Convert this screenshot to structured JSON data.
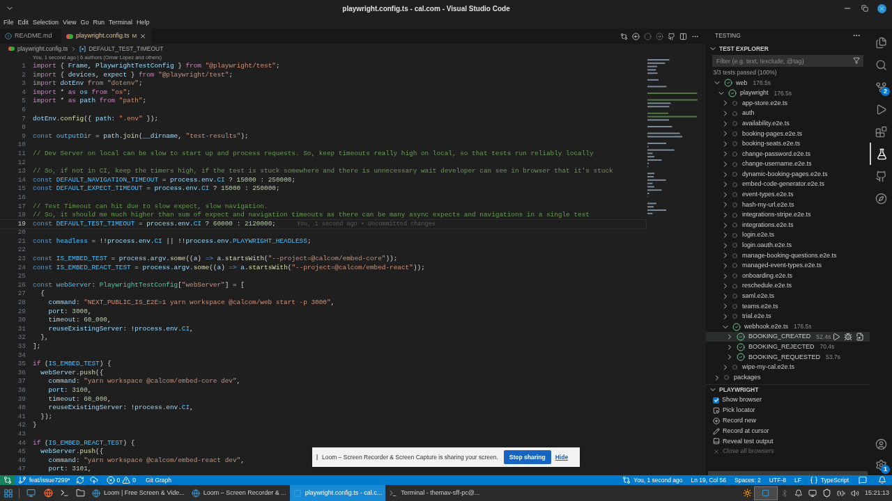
{
  "window": {
    "title": "playwright.config.ts - cal.com - Visual Studio Code"
  },
  "menu": [
    "File",
    "Edit",
    "Selection",
    "View",
    "Go",
    "Run",
    "Terminal",
    "Help"
  ],
  "tabs": [
    {
      "label": "README.md",
      "selected": false,
      "modified": false,
      "kind": "markdown"
    },
    {
      "label": "playwright.config.ts",
      "selected": true,
      "modified": true,
      "badge": "M",
      "kind": "playwright"
    }
  ],
  "breadcrumbs": [
    "playwright.config.ts",
    "DEFAULT_TEST_TIMEOUT"
  ],
  "blame_header": "You, 1 second ago | 6 authors (Omar López and others)",
  "code": [
    {
      "n": "1",
      "current": false,
      "tokens": [
        {
          "kind": "ctl",
          "text": "import"
        },
        {
          "kind": "p",
          "text": " { "
        },
        {
          "kind": "v",
          "text": "Frame"
        },
        {
          "kind": "p",
          "text": ", "
        },
        {
          "kind": "v",
          "text": "PlaywrightTestConfig"
        },
        {
          "kind": "p",
          "text": " } "
        },
        {
          "kind": "ctl",
          "text": "from "
        },
        {
          "kind": "s",
          "text": "\"@playwright/test\""
        },
        {
          "kind": "p",
          "text": ";"
        }
      ]
    },
    {
      "n": "2",
      "current": false,
      "tokens": [
        {
          "kind": "ctl",
          "text": "import"
        },
        {
          "kind": "p",
          "text": " { "
        },
        {
          "kind": "v",
          "text": "devices"
        },
        {
          "kind": "p",
          "text": ", "
        },
        {
          "kind": "v",
          "text": "expect"
        },
        {
          "kind": "p",
          "text": " } "
        },
        {
          "kind": "ctl",
          "text": "from "
        },
        {
          "kind": "s",
          "text": "\"@playwright/test\""
        },
        {
          "kind": "p",
          "text": ";"
        }
      ]
    },
    {
      "n": "3",
      "current": false,
      "tokens": [
        {
          "kind": "ctl",
          "text": "import "
        },
        {
          "kind": "v",
          "text": "dotEnv "
        },
        {
          "kind": "ctl",
          "text": "from "
        },
        {
          "kind": "s",
          "text": "\"dotenv\""
        },
        {
          "kind": "p",
          "text": ";"
        }
      ]
    },
    {
      "n": "4",
      "current": false,
      "tokens": [
        {
          "kind": "ctl",
          "text": "import"
        },
        {
          "kind": "p",
          "text": " * "
        },
        {
          "kind": "ctl",
          "text": "as "
        },
        {
          "kind": "v",
          "text": "os "
        },
        {
          "kind": "ctl",
          "text": "from "
        },
        {
          "kind": "s",
          "text": "\"os\""
        },
        {
          "kind": "p",
          "text": ";"
        }
      ]
    },
    {
      "n": "5",
      "current": false,
      "tokens": [
        {
          "kind": "ctl",
          "text": "import"
        },
        {
          "kind": "p",
          "text": " * "
        },
        {
          "kind": "ctl",
          "text": "as "
        },
        {
          "kind": "v",
          "text": "path "
        },
        {
          "kind": "ctl",
          "text": "from "
        },
        {
          "kind": "s",
          "text": "\"path\""
        },
        {
          "kind": "p",
          "text": ";"
        }
      ]
    },
    {
      "n": "6",
      "current": false
    },
    {
      "n": "7",
      "current": false,
      "tokens": [
        {
          "kind": "v",
          "text": "dotEnv"
        },
        {
          "kind": "p",
          "text": "."
        },
        {
          "kind": "f",
          "text": "config"
        },
        {
          "kind": "p",
          "text": "({ "
        },
        {
          "kind": "v",
          "text": "path"
        },
        {
          "kind": "p",
          "text": ": "
        },
        {
          "kind": "s",
          "text": "\".env\""
        },
        {
          "kind": "p",
          "text": " });"
        }
      ]
    },
    {
      "n": "8",
      "current": false
    },
    {
      "n": "9",
      "current": false,
      "tokens": [
        {
          "kind": "kw",
          "text": "const "
        },
        {
          "kind": "cn",
          "text": "outputDir"
        },
        {
          "kind": "p",
          "text": " = "
        },
        {
          "kind": "v",
          "text": "path"
        },
        {
          "kind": "p",
          "text": "."
        },
        {
          "kind": "f",
          "text": "join"
        },
        {
          "kind": "p",
          "text": "("
        },
        {
          "kind": "v",
          "text": "__dirname"
        },
        {
          "kind": "p",
          "text": ", "
        },
        {
          "kind": "s",
          "text": "\"test-results\""
        },
        {
          "kind": "p",
          "text": ");"
        }
      ]
    },
    {
      "n": "10",
      "current": false
    },
    {
      "n": "11",
      "current": false,
      "tokens": [
        {
          "kind": "c",
          "text": "// Dev Server on local can be slow to start up and process requests. So, keep timeouts really high on local, so that tests run reliably locally"
        }
      ]
    },
    {
      "n": "12",
      "current": false
    },
    {
      "n": "13",
      "current": false,
      "tokens": [
        {
          "kind": "c",
          "text": "// So, if not in CI, keep the timers high, if the test is stuck somewhere and there is unnecessary wait developer can see in browser that it's stuck"
        }
      ]
    },
    {
      "n": "14",
      "current": false,
      "tokens": [
        {
          "kind": "kw",
          "text": "const "
        },
        {
          "kind": "cn",
          "text": "DEFAULT_NAVIGATION_TIMEOUT"
        },
        {
          "kind": "p",
          "text": " = "
        },
        {
          "kind": "v",
          "text": "process.env."
        },
        {
          "kind": "cn",
          "text": "CI"
        },
        {
          "kind": "p",
          "text": " ? "
        },
        {
          "kind": "n",
          "text": "15000"
        },
        {
          "kind": "p",
          "text": " : "
        },
        {
          "kind": "n",
          "text": "250000"
        },
        {
          "kind": "p",
          "text": ";"
        }
      ]
    },
    {
      "n": "15",
      "current": false,
      "tokens": [
        {
          "kind": "kw",
          "text": "const "
        },
        {
          "kind": "cn",
          "text": "DEFAULT_EXPECT_TIMEOUT"
        },
        {
          "kind": "p",
          "text": " = "
        },
        {
          "kind": "v",
          "text": "process.env."
        },
        {
          "kind": "cn",
          "text": "CI"
        },
        {
          "kind": "p",
          "text": " ? "
        },
        {
          "kind": "n",
          "text": "15000"
        },
        {
          "kind": "p",
          "text": " : "
        },
        {
          "kind": "n",
          "text": "250000"
        },
        {
          "kind": "p",
          "text": ";"
        }
      ]
    },
    {
      "n": "16",
      "current": false
    },
    {
      "n": "17",
      "current": false,
      "tokens": [
        {
          "kind": "c",
          "text": "// Test Timeout can hit due to slow expect, slow navigation."
        }
      ]
    },
    {
      "n": "18",
      "current": false,
      "tokens": [
        {
          "kind": "c",
          "text": "// So, it should me much higher than sum of expect and navigation timeouts as there can be many async expects and navigations in a single test"
        }
      ]
    },
    {
      "n": "19",
      "current": true,
      "annotation": "You, 1 second ago • Uncommitted changes",
      "tokens": [
        {
          "kind": "kw",
          "text": "const "
        },
        {
          "kind": "cn",
          "text": "DEFAULT_TEST_TIMEOUT"
        },
        {
          "kind": "p",
          "text": " = "
        },
        {
          "kind": "v",
          "text": "process.env."
        },
        {
          "kind": "cn",
          "text": "CI"
        },
        {
          "kind": "p",
          "text": " ? "
        },
        {
          "kind": "n",
          "text": "60000"
        },
        {
          "kind": "p",
          "text": " : "
        },
        {
          "kind": "n",
          "text": "2120000"
        },
        {
          "kind": "p",
          "text": ";"
        }
      ]
    },
    {
      "n": "20",
      "current": false
    },
    {
      "n": "21",
      "current": false,
      "tokens": [
        {
          "kind": "kw",
          "text": "const "
        },
        {
          "kind": "cn",
          "text": "headless"
        },
        {
          "kind": "p",
          "text": " = !!"
        },
        {
          "kind": "v",
          "text": "process.env."
        },
        {
          "kind": "cn",
          "text": "CI"
        },
        {
          "kind": "p",
          "text": " || !!"
        },
        {
          "kind": "v",
          "text": "process.env."
        },
        {
          "kind": "cn",
          "text": "PLAYWRIGHT_HEADLESS"
        },
        {
          "kind": "p",
          "text": ";"
        }
      ]
    },
    {
      "n": "22",
      "current": false
    },
    {
      "n": "23",
      "current": false,
      "tokens": [
        {
          "kind": "kw",
          "text": "const "
        },
        {
          "kind": "cn",
          "text": "IS_EMBED_TEST"
        },
        {
          "kind": "p",
          "text": " = "
        },
        {
          "kind": "v",
          "text": "process.argv."
        },
        {
          "kind": "f",
          "text": "some"
        },
        {
          "kind": "p",
          "text": "(("
        },
        {
          "kind": "v",
          "text": "a"
        },
        {
          "kind": "p",
          "text": ") "
        },
        {
          "kind": "kw",
          "text": "=> "
        },
        {
          "kind": "v",
          "text": "a"
        },
        {
          "kind": "p",
          "text": "."
        },
        {
          "kind": "f",
          "text": "startsWith"
        },
        {
          "kind": "p",
          "text": "("
        },
        {
          "kind": "s",
          "text": "\"--project=@calcom/embed-core\""
        },
        {
          "kind": "p",
          "text": "));"
        }
      ]
    },
    {
      "n": "24",
      "current": false,
      "tokens": [
        {
          "kind": "kw",
          "text": "const "
        },
        {
          "kind": "cn",
          "text": "IS_EMBED_REACT_TEST"
        },
        {
          "kind": "p",
          "text": " = "
        },
        {
          "kind": "v",
          "text": "process.argv."
        },
        {
          "kind": "f",
          "text": "some"
        },
        {
          "kind": "p",
          "text": "(("
        },
        {
          "kind": "v",
          "text": "a"
        },
        {
          "kind": "p",
          "text": ") "
        },
        {
          "kind": "kw",
          "text": "=> "
        },
        {
          "kind": "v",
          "text": "a"
        },
        {
          "kind": "p",
          "text": "."
        },
        {
          "kind": "f",
          "text": "startsWith"
        },
        {
          "kind": "p",
          "text": "("
        },
        {
          "kind": "s",
          "text": "\"--project=@calcom/embed-react\""
        },
        {
          "kind": "p",
          "text": "));"
        }
      ]
    },
    {
      "n": "25",
      "current": false
    },
    {
      "n": "26",
      "current": false,
      "tokens": [
        {
          "kind": "kw",
          "text": "const "
        },
        {
          "kind": "cn",
          "text": "webServer"
        },
        {
          "kind": "p",
          "text": ": "
        },
        {
          "kind": "t",
          "text": "PlaywrightTestConfig"
        },
        {
          "kind": "p",
          "text": "["
        },
        {
          "kind": "s",
          "text": "\"webServer\""
        },
        {
          "kind": "p",
          "text": "] = ["
        }
      ]
    },
    {
      "n": "27",
      "current": false,
      "tokens": [
        {
          "kind": "p",
          "text": "  {"
        }
      ]
    },
    {
      "n": "28",
      "current": false,
      "tokens": [
        {
          "kind": "v",
          "text": "    command"
        },
        {
          "kind": "p",
          "text": ": "
        },
        {
          "kind": "s",
          "text": "\"NEXT_PUBLIC_IS_E2E=1 yarn workspace @calcom/web start -p 3000\""
        },
        {
          "kind": "p",
          "text": ","
        }
      ]
    },
    {
      "n": "29",
      "current": false,
      "tokens": [
        {
          "kind": "v",
          "text": "    port"
        },
        {
          "kind": "p",
          "text": ": "
        },
        {
          "kind": "n",
          "text": "3000"
        },
        {
          "kind": "p",
          "text": ","
        }
      ]
    },
    {
      "n": "30",
      "current": false,
      "tokens": [
        {
          "kind": "v",
          "text": "    timeout"
        },
        {
          "kind": "p",
          "text": ": "
        },
        {
          "kind": "n",
          "text": "60_000"
        },
        {
          "kind": "p",
          "text": ","
        }
      ]
    },
    {
      "n": "31",
      "current": false,
      "tokens": [
        {
          "kind": "v",
          "text": "    reuseExistingServer"
        },
        {
          "kind": "p",
          "text": ": !"
        },
        {
          "kind": "v",
          "text": "process.env."
        },
        {
          "kind": "cn",
          "text": "CI"
        },
        {
          "kind": "p",
          "text": ","
        }
      ]
    },
    {
      "n": "32",
      "current": false,
      "tokens": [
        {
          "kind": "p",
          "text": "  },"
        }
      ]
    },
    {
      "n": "33",
      "current": false,
      "tokens": [
        {
          "kind": "p",
          "text": "];"
        }
      ]
    },
    {
      "n": "34",
      "current": false
    },
    {
      "n": "35",
      "current": false,
      "tokens": [
        {
          "kind": "ctl",
          "text": "if"
        },
        {
          "kind": "p",
          "text": " ("
        },
        {
          "kind": "cn",
          "text": "IS_EMBED_TEST"
        },
        {
          "kind": "p",
          "text": ") {"
        }
      ]
    },
    {
      "n": "36",
      "current": false,
      "tokens": [
        {
          "kind": "v",
          "text": "  webServer"
        },
        {
          "kind": "p",
          "text": "."
        },
        {
          "kind": "f",
          "text": "push"
        },
        {
          "kind": "p",
          "text": "({"
        }
      ]
    },
    {
      "n": "37",
      "current": false,
      "tokens": [
        {
          "kind": "v",
          "text": "    command"
        },
        {
          "kind": "p",
          "text": ": "
        },
        {
          "kind": "s",
          "text": "\"yarn workspace @calcom/embed-core dev\""
        },
        {
          "kind": "p",
          "text": ","
        }
      ]
    },
    {
      "n": "38",
      "current": false,
      "tokens": [
        {
          "kind": "v",
          "text": "    port"
        },
        {
          "kind": "p",
          "text": ": "
        },
        {
          "kind": "n",
          "text": "3100"
        },
        {
          "kind": "p",
          "text": ","
        }
      ]
    },
    {
      "n": "39",
      "current": false,
      "tokens": [
        {
          "kind": "v",
          "text": "    timeout"
        },
        {
          "kind": "p",
          "text": ": "
        },
        {
          "kind": "n",
          "text": "60_000"
        },
        {
          "kind": "p",
          "text": ","
        }
      ]
    },
    {
      "n": "40",
      "current": false,
      "tokens": [
        {
          "kind": "v",
          "text": "    reuseExistingServer"
        },
        {
          "kind": "p",
          "text": ": !"
        },
        {
          "kind": "v",
          "text": "process.env."
        },
        {
          "kind": "cn",
          "text": "CI"
        },
        {
          "kind": "p",
          "text": ","
        }
      ]
    },
    {
      "n": "41",
      "current": false,
      "tokens": [
        {
          "kind": "p",
          "text": "  });"
        }
      ]
    },
    {
      "n": "42",
      "current": false,
      "tokens": [
        {
          "kind": "p",
          "text": "}"
        }
      ]
    },
    {
      "n": "43",
      "current": false
    },
    {
      "n": "44",
      "current": false,
      "tokens": [
        {
          "kind": "ctl",
          "text": "if"
        },
        {
          "kind": "p",
          "text": " ("
        },
        {
          "kind": "cn",
          "text": "IS_EMBED_REACT_TEST"
        },
        {
          "kind": "p",
          "text": ") {"
        }
      ]
    },
    {
      "n": "45",
      "current": false,
      "tokens": [
        {
          "kind": "v",
          "text": "  webServer"
        },
        {
          "kind": "p",
          "text": "."
        },
        {
          "kind": "f",
          "text": "push"
        },
        {
          "kind": "p",
          "text": "({"
        }
      ]
    },
    {
      "n": "46",
      "current": false,
      "tokens": [
        {
          "kind": "v",
          "text": "    command"
        },
        {
          "kind": "p",
          "text": ": "
        },
        {
          "kind": "s",
          "text": "\"yarn workspace @calcom/embed-react dev\""
        },
        {
          "kind": "p",
          "text": ","
        }
      ]
    },
    {
      "n": "47",
      "current": false,
      "tokens": [
        {
          "kind": "v",
          "text": "    port"
        },
        {
          "kind": "p",
          "text": ": "
        },
        {
          "kind": "n",
          "text": "3101"
        },
        {
          "kind": "p",
          "text": ","
        }
      ]
    }
  ],
  "sidebar": {
    "title": "TESTING",
    "section": "TEST EXPLORER",
    "filter": {
      "placeholder": "Filter (e.g. text, !exclude, @tag)"
    },
    "summary": "3/3 tests passed (100%)",
    "tree": [
      {
        "label": "web",
        "passed": true,
        "expanded": true,
        "selected": false,
        "duration": "176.5s",
        "children": [
          {
            "label": "playwright",
            "passed": true,
            "expanded": true,
            "selected": false,
            "duration": "176.5s",
            "children": [
              {
                "label": "app-store.e2e.ts",
                "passed": false,
                "expanded": false,
                "selected": false
              },
              {
                "label": "auth",
                "passed": false,
                "expanded": false,
                "selected": false
              },
              {
                "label": "availability.e2e.ts",
                "passed": false,
                "expanded": false,
                "selected": false
              },
              {
                "label": "booking-pages.e2e.ts",
                "passed": false,
                "expanded": false,
                "selected": false
              },
              {
                "label": "booking-seats.e2e.ts",
                "passed": false,
                "expanded": false,
                "selected": false
              },
              {
                "label": "change-password.e2e.ts",
                "passed": false,
                "expanded": false,
                "selected": false
              },
              {
                "label": "change-username.e2e.ts",
                "passed": false,
                "expanded": false,
                "selected": false
              },
              {
                "label": "dynamic-booking-pages.e2e.ts",
                "passed": false,
                "expanded": false,
                "selected": false
              },
              {
                "label": "embed-code-generator.e2e.ts",
                "passed": false,
                "expanded": false,
                "selected": false
              },
              {
                "label": "event-types.e2e.ts",
                "passed": false,
                "expanded": false,
                "selected": false
              },
              {
                "label": "hash-my-url.e2e.ts",
                "passed": false,
                "expanded": false,
                "selected": false
              },
              {
                "label": "integrations-stripe.e2e.ts",
                "passed": false,
                "expanded": false,
                "selected": false
              },
              {
                "label": "integrations.e2e.ts",
                "passed": false,
                "expanded": false,
                "selected": false
              },
              {
                "label": "login.e2e.ts",
                "passed": false,
                "expanded": false,
                "selected": false
              },
              {
                "label": "login.oauth.e2e.ts",
                "passed": false,
                "expanded": false,
                "selected": false
              },
              {
                "label": "manage-booking-questions.e2e.ts",
                "passed": false,
                "expanded": false,
                "selected": false
              },
              {
                "label": "managed-event-types.e2e.ts",
                "passed": false,
                "expanded": false,
                "selected": false
              },
              {
                "label": "onboarding.e2e.ts",
                "passed": false,
                "expanded": false,
                "selected": false
              },
              {
                "label": "reschedule.e2e.ts",
                "passed": false,
                "expanded": false,
                "selected": false
              },
              {
                "label": "saml.e2e.ts",
                "passed": false,
                "expanded": false,
                "selected": false
              },
              {
                "label": "teams.e2e.ts",
                "passed": false,
                "expanded": false,
                "selected": false
              },
              {
                "label": "trial.e2e.ts",
                "passed": false,
                "expanded": false,
                "selected": false
              },
              {
                "label": "webhook.e2e.ts",
                "passed": true,
                "expanded": true,
                "selected": false,
                "duration": "176.5s",
                "children": [
                  {
                    "label": "BOOKING_CREATED",
                    "passed": true,
                    "expanded": false,
                    "selected": true,
                    "duration": "52.4s"
                  },
                  {
                    "label": "BOOKING_REJECTED",
                    "passed": true,
                    "expanded": false,
                    "selected": false,
                    "duration": "70.4s"
                  },
                  {
                    "label": "BOOKING_REQUESTED",
                    "passed": true,
                    "expanded": false,
                    "selected": false,
                    "duration": "53.7s"
                  }
                ]
              },
              {
                "label": "wipe-my-cal.e2e.ts",
                "passed": false,
                "expanded": false,
                "selected": false
              }
            ]
          }
        ]
      },
      {
        "label": "packages",
        "passed": false,
        "expanded": false,
        "selected": false
      }
    ],
    "playwright": {
      "title": "PLAYWRIGHT",
      "items": [
        {
          "kind": "checkbox",
          "label": "Show browser",
          "checked": true,
          "disabled": false
        },
        {
          "kind": "action",
          "label": "Pick locator",
          "disabled": false
        },
        {
          "kind": "action",
          "label": "Record new",
          "disabled": false
        },
        {
          "kind": "action",
          "label": "Record at cursor",
          "disabled": false
        },
        {
          "kind": "action",
          "label": "Reveal test output",
          "disabled": false
        },
        {
          "kind": "action",
          "label": "Close all browsers",
          "disabled": true
        }
      ]
    }
  },
  "activity_bar": [
    {
      "selected": false
    },
    {
      "selected": false
    },
    {
      "selected": false,
      "badge": "2"
    },
    {
      "selected": false
    },
    {
      "selected": false
    },
    {
      "selected": true
    },
    {
      "selected": false
    },
    {
      "selected": false
    }
  ],
  "activity_bottom": [
    {
      "kind": "account"
    },
    {
      "kind": "settings",
      "badge": "1"
    }
  ],
  "status_bar": {
    "left": [
      {
        "kind": "remote"
      },
      {
        "kind": "branch",
        "text": "feat/issue7299*"
      },
      {
        "kind": "sync"
      },
      {
        "kind": "publish"
      },
      {
        "kind": "problems",
        "errors": "0",
        "warnings": "0"
      },
      {
        "kind": "text",
        "text": "Git Graph"
      }
    ],
    "right": [
      {
        "kind": "blame",
        "text": "You, 1 second ago"
      },
      {
        "kind": "text",
        "text": "Ln 19, Col 56"
      },
      {
        "kind": "text",
        "text": "Spaces: 2"
      },
      {
        "kind": "text",
        "text": "UTF-8"
      },
      {
        "kind": "text",
        "text": "LF"
      },
      {
        "kind": "language",
        "text": "TypeScript"
      },
      {
        "kind": "feedback"
      },
      {
        "kind": "bell"
      }
    ]
  },
  "toast": {
    "message": "Loom – Screen Recorder & Screen Capture is sharing your screen.",
    "button": "Stop sharing",
    "link": "Hide"
  },
  "taskbar": {
    "tasks": [
      {
        "kind": "edge",
        "title": "Loom | Free Screen & Vide...",
        "selected": false
      },
      {
        "kind": "edge",
        "title": "Loom – Screen Recorder & ...",
        "selected": false
      },
      {
        "kind": "vscode",
        "title": "playwright.config.ts - cal.c...",
        "selected": true
      },
      {
        "kind": "terminal",
        "title": "Terminal - themav-sff-pc@...",
        "selected": false
      }
    ],
    "clock": "15:21:13"
  }
}
